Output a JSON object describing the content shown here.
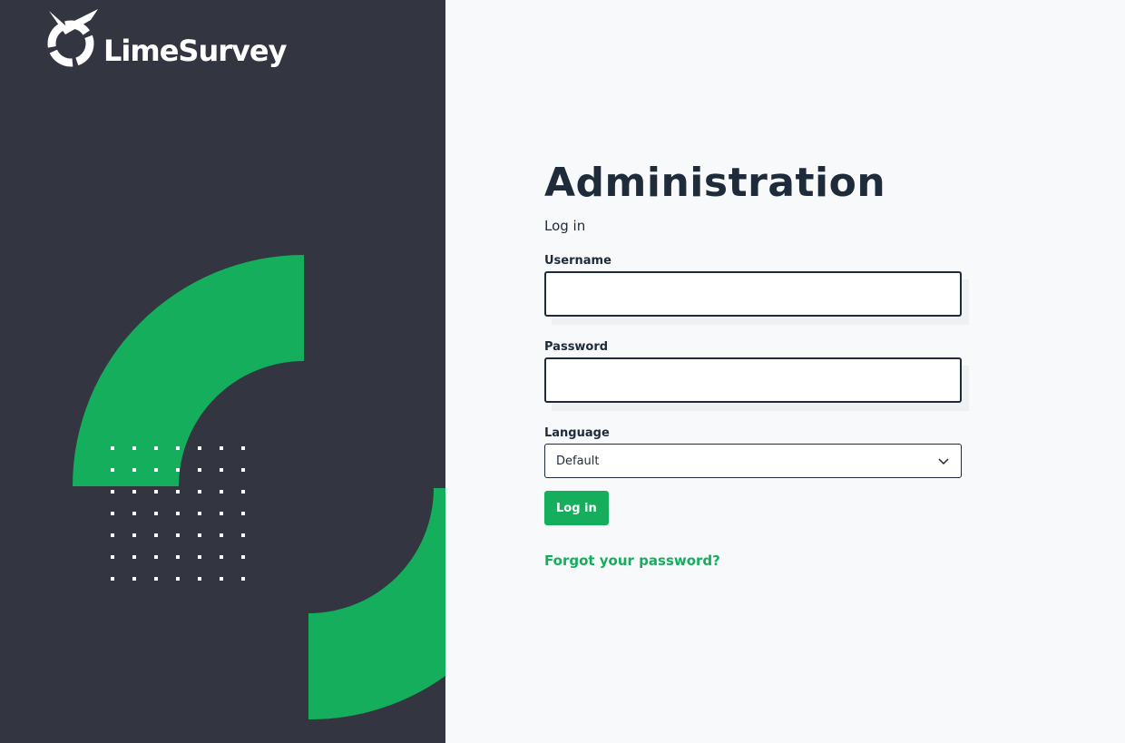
{
  "brand": {
    "name": "LimeSurvey"
  },
  "colors": {
    "sidebar": "#333641",
    "accent": "#14ae5c",
    "text": "#1e2b3a",
    "background": "#f8f9fb"
  },
  "icons": {
    "logo": "limesurvey-logo-icon",
    "select": "chevron-down-icon"
  },
  "login": {
    "title": "Administration",
    "subtitle": "Log in",
    "username_label": "Username",
    "username_value": "",
    "password_label": "Password",
    "password_value": "",
    "language_label": "Language",
    "language_value": "Default",
    "submit_label": "Log in",
    "forgot_label": "Forgot your password?"
  }
}
